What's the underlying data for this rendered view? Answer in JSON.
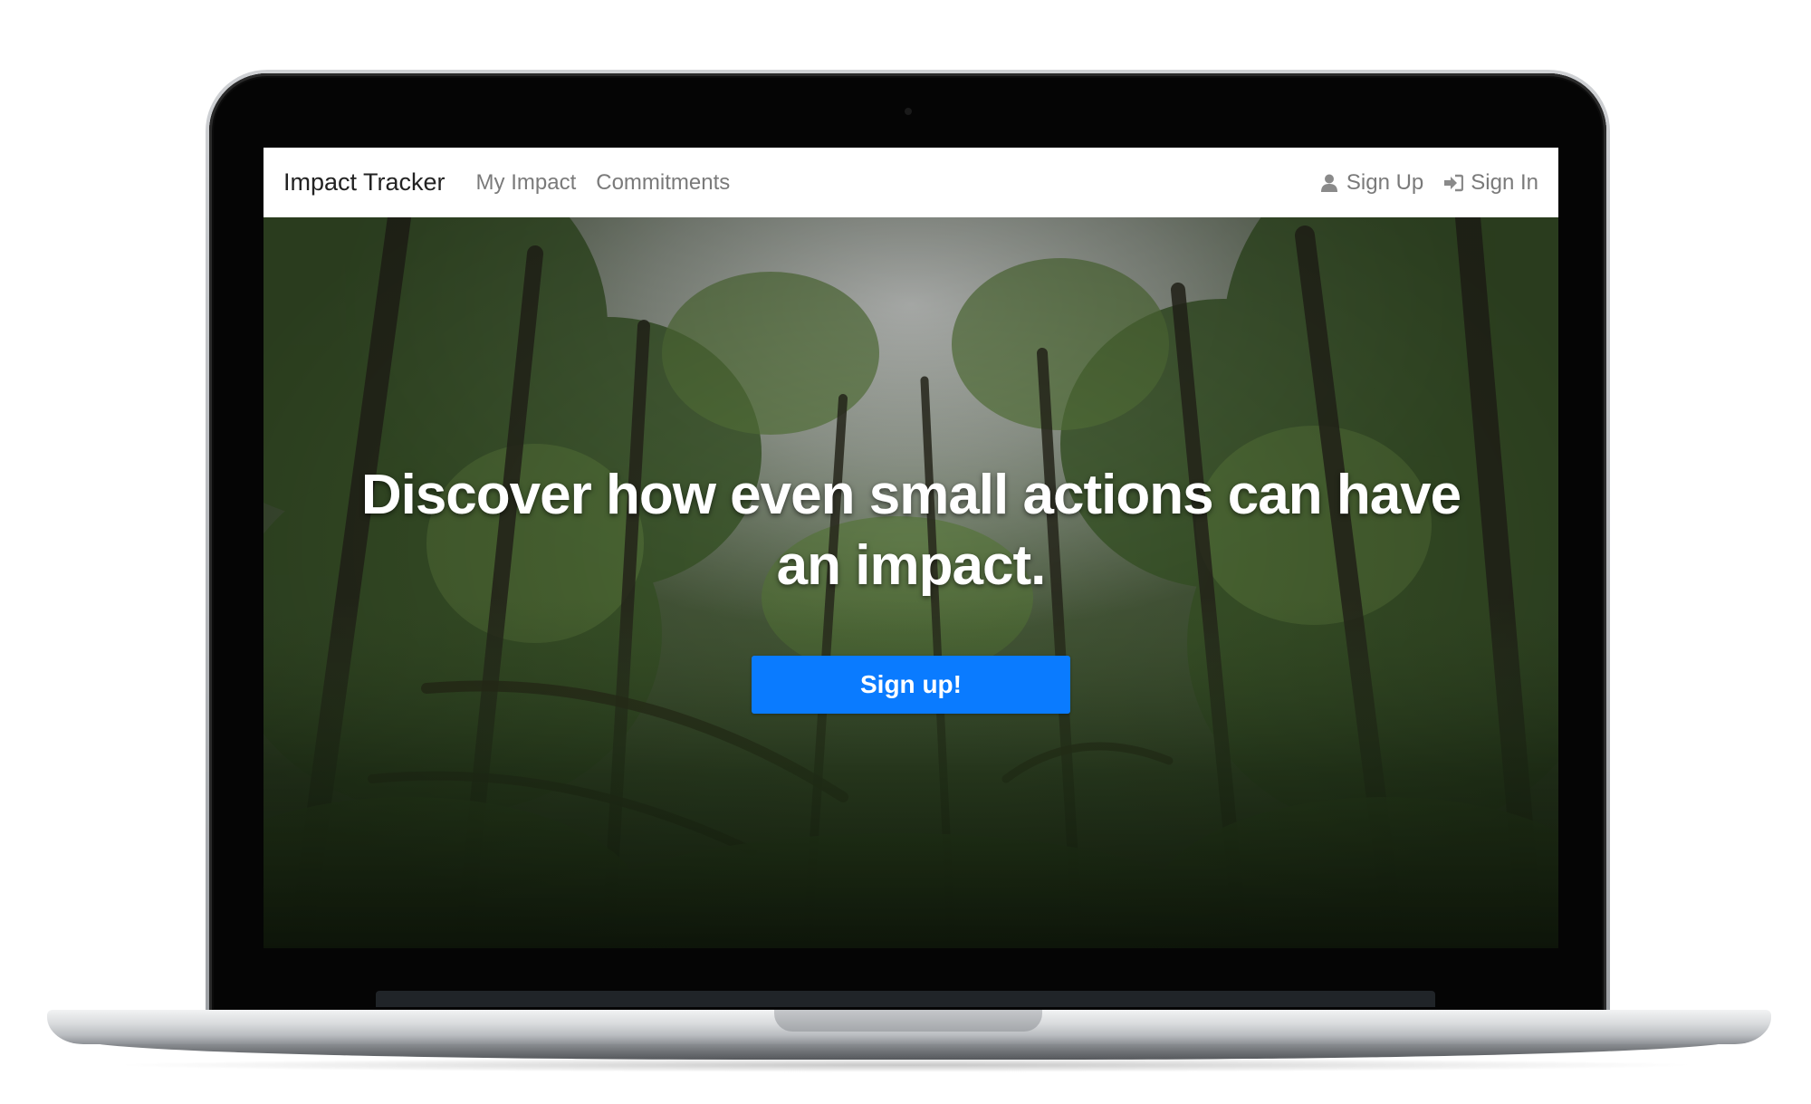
{
  "navbar": {
    "brand": "Impact Tracker",
    "links": [
      {
        "label": "My Impact"
      },
      {
        "label": "Commitments"
      }
    ],
    "right": [
      {
        "label": "Sign Up",
        "icon": "user-icon"
      },
      {
        "label": "Sign In",
        "icon": "sign-in-icon"
      }
    ]
  },
  "hero": {
    "headline": "Discover how even small actions can have an impact.",
    "button_label": "Sign up!",
    "background": "forest-photo"
  },
  "colors": {
    "primary": "#0a7bff",
    "nav_link": "#7a7a7a",
    "brand_text": "#222222",
    "headline": "#ffffff"
  }
}
